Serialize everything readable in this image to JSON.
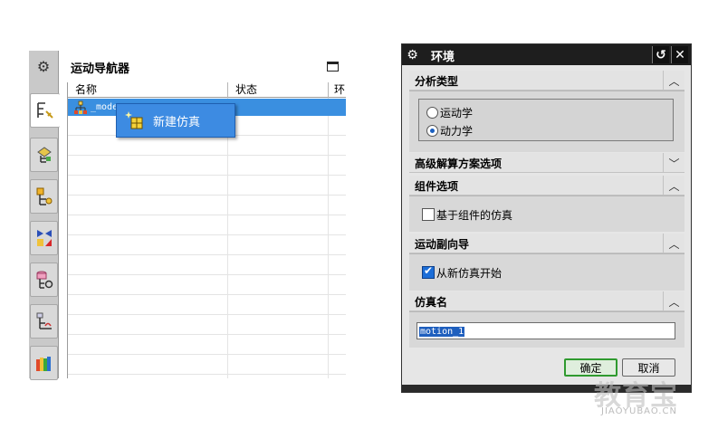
{
  "navigator": {
    "title": "运动导航器",
    "columns": [
      "名称",
      "状态",
      "环"
    ],
    "model_node": "_mode",
    "context_menu": {
      "new_simulation": "新建仿真"
    },
    "side_tabs": [
      "assembly-navigator",
      "constraint-navigator",
      "part-navigator",
      "reuse-library",
      "hd3d-tools",
      "web-browser",
      "history",
      "system-materials"
    ]
  },
  "environment_dialog": {
    "title": "环境",
    "sections": {
      "analysis_type": {
        "label": "分析类型",
        "options": [
          "运动学",
          "动力学"
        ],
        "selected": "动力学"
      },
      "advanced_solver": {
        "label": "高级解算方案选项"
      },
      "component_options": {
        "label": "组件选项",
        "checkbox_label": "基于组件的仿真",
        "checked": false
      },
      "motion_wizard": {
        "label": "运动副向导",
        "checkbox_label": "从新仿真开始",
        "checked": true
      },
      "simulation_name": {
        "label": "仿真名",
        "value": "motion_1"
      }
    },
    "buttons": {
      "ok": "确定",
      "cancel": "取消"
    }
  },
  "watermark": {
    "logo": "教育宝",
    "url": "JIAOYUBAO.CN"
  },
  "colors": {
    "selection": "#3a8fe0",
    "ok_border": "#2f9a2f",
    "titlebar": "#1e1e1e"
  }
}
